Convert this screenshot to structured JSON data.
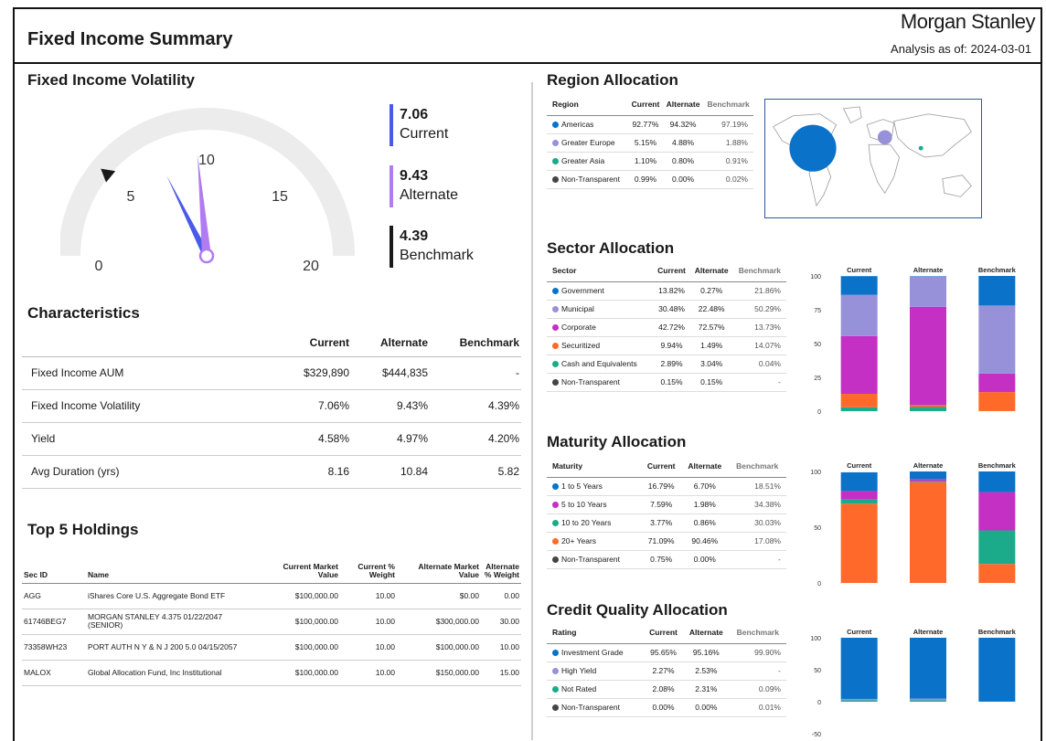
{
  "header": {
    "title": "Fixed Income Summary",
    "brand": "Morgan Stanley",
    "asof_label": "Analysis as of:",
    "asof_date": "2024-03-01"
  },
  "volatility": {
    "title": "Fixed Income Volatility",
    "ticks": [
      "0",
      "5",
      "10",
      "15",
      "20"
    ],
    "gauge_max": 20,
    "current": {
      "value": "7.06",
      "label": "Current",
      "num": 7.06,
      "color": "#4a5ae8"
    },
    "alternate": {
      "value": "9.43",
      "label": "Alternate",
      "num": 9.43,
      "color": "#b07cf0"
    },
    "benchmark": {
      "value": "4.39",
      "label": "Benchmark",
      "num": 4.39,
      "color": "#1a1a1a"
    }
  },
  "characteristics": {
    "title": "Characteristics",
    "columns": [
      "Current",
      "Alternate",
      "Benchmark"
    ],
    "rows": [
      {
        "label": "Fixed Income AUM",
        "current": "$329,890",
        "alternate": "$444,835",
        "benchmark": "-"
      },
      {
        "label": "Fixed Income Volatility",
        "current": "7.06%",
        "alternate": "9.43%",
        "benchmark": "4.39%"
      },
      {
        "label": "Yield",
        "current": "4.58%",
        "alternate": "4.97%",
        "benchmark": "4.20%"
      },
      {
        "label": "Avg Duration (yrs)",
        "current": "8.16",
        "alternate": "10.84",
        "benchmark": "5.82"
      }
    ]
  },
  "holdings": {
    "title": "Top 5 Holdings",
    "columns": {
      "sec_id": "Sec ID",
      "name": "Name",
      "cur_mv": "Current Market Value",
      "cur_w": "Current % Weight",
      "alt_mv": "Alternate Market Value",
      "alt_w": "Alternate % Weight"
    },
    "rows": [
      {
        "sec_id": "AGG",
        "name": "iShares Core U.S. Aggregate Bond ETF",
        "cur_mv": "$100,000.00",
        "cur_w": "10.00",
        "alt_mv": "$0.00",
        "alt_w": "0.00"
      },
      {
        "sec_id": "61746BEG7",
        "name": "MORGAN STANLEY 4.375 01/22/2047 (SENIOR)",
        "cur_mv": "$100,000.00",
        "cur_w": "10.00",
        "alt_mv": "$300,000.00",
        "alt_w": "30.00"
      },
      {
        "sec_id": "73358WH23",
        "name": "PORT AUTH N Y & N J 200 5.0 04/15/2057",
        "cur_mv": "$100,000.00",
        "cur_w": "10.00",
        "alt_mv": "$100,000.00",
        "alt_w": "10.00"
      },
      {
        "sec_id": "MALOX",
        "name": "Global Allocation Fund, Inc Institutional",
        "cur_mv": "$100,000.00",
        "cur_w": "10.00",
        "alt_mv": "$150,000.00",
        "alt_w": "15.00"
      }
    ]
  },
  "colors": {
    "blue": "#0a72c8",
    "lavender": "#9691d9",
    "magenta": "#c42fc4",
    "orange": "#ff6a2b",
    "teal": "#1bab8a",
    "dark": "#444444"
  },
  "region": {
    "title": "Region Allocation",
    "columns": [
      "Region",
      "Current",
      "Alternate",
      "Benchmark"
    ],
    "rows": [
      {
        "label": "Americas",
        "color": "#0a72c8",
        "current": "92.77%",
        "alternate": "94.32%",
        "benchmark": "97.19%"
      },
      {
        "label": "Greater Europe",
        "color": "#9691d9",
        "current": "5.15%",
        "alternate": "4.88%",
        "benchmark": "1.88%"
      },
      {
        "label": "Greater Asia",
        "color": "#1bab8a",
        "current": "1.10%",
        "alternate": "0.80%",
        "benchmark": "0.91%"
      },
      {
        "label": "Non-Transparent",
        "color": "#444444",
        "current": "0.99%",
        "alternate": "0.00%",
        "benchmark": "0.02%"
      }
    ]
  },
  "sector": {
    "title": "Sector Allocation",
    "columns": [
      "Sector",
      "Current",
      "Alternate",
      "Benchmark"
    ],
    "rows": [
      {
        "label": "Government",
        "color": "#0a72c8",
        "current": "13.82%",
        "alternate": "0.27%",
        "benchmark": "21.86%"
      },
      {
        "label": "Municipal",
        "color": "#9691d9",
        "current": "30.48%",
        "alternate": "22.48%",
        "benchmark": "50.29%"
      },
      {
        "label": "Corporate",
        "color": "#c42fc4",
        "current": "42.72%",
        "alternate": "72.57%",
        "benchmark": "13.73%"
      },
      {
        "label": "Securitized",
        "color": "#ff6a2b",
        "current": "9.94%",
        "alternate": "1.49%",
        "benchmark": "14.07%"
      },
      {
        "label": "Cash and Equivalents",
        "color": "#1bab8a",
        "current": "2.89%",
        "alternate": "3.04%",
        "benchmark": "0.04%"
      },
      {
        "label": "Non-Transparent",
        "color": "#444444",
        "current": "0.15%",
        "alternate": "0.15%",
        "benchmark": "-"
      }
    ]
  },
  "maturity": {
    "title": "Maturity Allocation",
    "columns": [
      "Maturity",
      "Current",
      "Alternate",
      "Benchmark"
    ],
    "rows": [
      {
        "label": "1 to 5 Years",
        "color": "#0a72c8",
        "current": "16.79%",
        "alternate": "6.70%",
        "benchmark": "18.51%"
      },
      {
        "label": "5 to 10 Years",
        "color": "#c42fc4",
        "current": "7.59%",
        "alternate": "1.98%",
        "benchmark": "34.38%"
      },
      {
        "label": "10 to 20 Years",
        "color": "#1bab8a",
        "current": "3.77%",
        "alternate": "0.86%",
        "benchmark": "30.03%"
      },
      {
        "label": "20+ Years",
        "color": "#ff6a2b",
        "current": "71.09%",
        "alternate": "90.46%",
        "benchmark": "17.08%"
      },
      {
        "label": "Non-Transparent",
        "color": "#444444",
        "current": "0.75%",
        "alternate": "0.00%",
        "benchmark": "-"
      }
    ]
  },
  "credit": {
    "title": "Credit Quality Allocation",
    "columns": [
      "Rating",
      "Current",
      "Alternate",
      "Benchmark"
    ],
    "rows": [
      {
        "label": "Investment Grade",
        "color": "#0a72c8",
        "current": "95.65%",
        "alternate": "95.16%",
        "benchmark": "99.90%"
      },
      {
        "label": "High Yield",
        "color": "#9691d9",
        "current": "2.27%",
        "alternate": "2.53%",
        "benchmark": "-"
      },
      {
        "label": "Not Rated",
        "color": "#1bab8a",
        "current": "2.08%",
        "alternate": "2.31%",
        "benchmark": "0.09%"
      },
      {
        "label": "Non-Transparent",
        "color": "#444444",
        "current": "0.00%",
        "alternate": "0.00%",
        "benchmark": "0.01%"
      }
    ]
  },
  "chart_data": [
    {
      "type": "bar",
      "stacked": true,
      "id": "sector",
      "categories": [
        "Current",
        "Alternate",
        "Benchmark"
      ],
      "ylim": [
        0,
        100
      ],
      "yticks": [
        "0",
        "25",
        "50",
        "75",
        "100"
      ],
      "series": [
        {
          "name": "Cash and Equivalents",
          "color": "#1bab8a",
          "values": [
            2.89,
            3.04,
            0.04
          ]
        },
        {
          "name": "Securitized",
          "color": "#ff6a2b",
          "values": [
            9.94,
            1.49,
            14.07
          ]
        },
        {
          "name": "Corporate",
          "color": "#c42fc4",
          "values": [
            42.72,
            72.57,
            13.73
          ]
        },
        {
          "name": "Municipal",
          "color": "#9691d9",
          "values": [
            30.48,
            22.48,
            50.29
          ]
        },
        {
          "name": "Government",
          "color": "#0a72c8",
          "values": [
            13.82,
            0.27,
            21.86
          ]
        }
      ]
    },
    {
      "type": "bar",
      "stacked": true,
      "id": "maturity",
      "categories": [
        "Current",
        "Alternate",
        "Benchmark"
      ],
      "ylim": [
        0,
        100
      ],
      "yticks": [
        "0",
        "50",
        "100"
      ],
      "series": [
        {
          "name": "20+ Years",
          "color": "#ff6a2b",
          "values": [
            71.09,
            90.46,
            17.08
          ]
        },
        {
          "name": "10 to 20 Years",
          "color": "#1bab8a",
          "values": [
            3.77,
            0.86,
            30.03
          ]
        },
        {
          "name": "5 to 10 Years",
          "color": "#c42fc4",
          "values": [
            7.59,
            1.98,
            34.38
          ]
        },
        {
          "name": "1 to 5 Years",
          "color": "#0a72c8",
          "values": [
            16.79,
            6.7,
            18.51
          ]
        }
      ]
    },
    {
      "type": "bar",
      "stacked": true,
      "id": "credit",
      "categories": [
        "Current",
        "Alternate",
        "Benchmark"
      ],
      "ylim": [
        -50,
        100
      ],
      "yticks": [
        "-50",
        "0",
        "50",
        "100"
      ],
      "series": [
        {
          "name": "Not Rated",
          "color": "#1bab8a",
          "values": [
            2.08,
            2.31,
            0.09
          ]
        },
        {
          "name": "High Yield",
          "color": "#9691d9",
          "values": [
            2.27,
            2.53,
            0
          ]
        },
        {
          "name": "Investment Grade",
          "color": "#0a72c8",
          "values": [
            95.65,
            95.16,
            99.9
          ]
        }
      ]
    }
  ]
}
